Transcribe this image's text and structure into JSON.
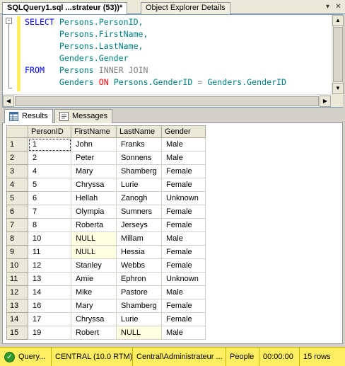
{
  "doc_tabs": [
    {
      "label": "SQLQuery1.sql ...strateur (53))*",
      "active": true
    },
    {
      "label": "Object Explorer Details",
      "active": false
    }
  ],
  "window_buttons": {
    "dropdown_icon": "dropdown-arrow-icon",
    "close_icon": "close-icon"
  },
  "editor": {
    "lines": [
      {
        "t1": "SELECT",
        "t2": "Persons.PersonID,"
      },
      {
        "t1": "",
        "t2": "Persons.FirstName,"
      },
      {
        "t1": "",
        "t2": "Persons.LastName,"
      },
      {
        "t1": "",
        "t2": "Genders.Gender"
      },
      {
        "t1": "FROM",
        "t2": "Persons",
        "t3": "INNER JOIN"
      },
      {
        "t1": "",
        "t2": "Genders",
        "t3": "ON",
        "t4": "Persons.GenderID",
        "t5": "=",
        "t6": "Genders.GenderID"
      }
    ],
    "collapse_symbol": "-"
  },
  "result_tabs": [
    {
      "label": "Results",
      "icon": "grid-icon",
      "active": true
    },
    {
      "label": "Messages",
      "icon": "messages-icon",
      "active": false
    }
  ],
  "grid": {
    "columns": [
      "PersonID",
      "FirstName",
      "LastName",
      "Gender"
    ],
    "rows": [
      {
        "n": "1",
        "cells": [
          "1",
          "John",
          "Franks",
          "Male"
        ]
      },
      {
        "n": "2",
        "cells": [
          "2",
          "Peter",
          "Sonnens",
          "Male"
        ]
      },
      {
        "n": "3",
        "cells": [
          "4",
          "Mary",
          "Shamberg",
          "Female"
        ]
      },
      {
        "n": "4",
        "cells": [
          "5",
          "Chryssa",
          "Lurie",
          "Female"
        ]
      },
      {
        "n": "5",
        "cells": [
          "6",
          "Hellah",
          "Zanogh",
          "Unknown"
        ]
      },
      {
        "n": "6",
        "cells": [
          "7",
          "Olympia",
          "Sumners",
          "Female"
        ]
      },
      {
        "n": "7",
        "cells": [
          "8",
          "Roberta",
          "Jerseys",
          "Female"
        ]
      },
      {
        "n": "8",
        "cells": [
          "10",
          "NULL",
          "Millam",
          "Male"
        ]
      },
      {
        "n": "9",
        "cells": [
          "11",
          "NULL",
          "Hessia",
          "Female"
        ]
      },
      {
        "n": "10",
        "cells": [
          "12",
          "Stanley",
          "Webbs",
          "Female"
        ]
      },
      {
        "n": "11",
        "cells": [
          "13",
          "Amie",
          "Ephron",
          "Unknown"
        ]
      },
      {
        "n": "12",
        "cells": [
          "14",
          "Mike",
          "Pastore",
          "Male"
        ]
      },
      {
        "n": "13",
        "cells": [
          "16",
          "Mary",
          "Shamberg",
          "Female"
        ]
      },
      {
        "n": "14",
        "cells": [
          "17",
          "Chryssa",
          "Lurie",
          "Female"
        ]
      },
      {
        "n": "15",
        "cells": [
          "19",
          "Robert",
          "NULL",
          "Male"
        ]
      }
    ]
  },
  "status_bar": {
    "state_icon": "success-check-icon",
    "state": "Query...",
    "server": "CENTRAL (10.0 RTM)",
    "user": "Central\\Administrateur ...",
    "database": "People",
    "elapsed": "00:00:00",
    "rows": "15 rows"
  },
  "colors": {
    "keyword": "#0000ff",
    "identifier": "#008080",
    "operator_gray": "#808080",
    "on_keyword": "#ff0000",
    "status_bar": "#ffee62",
    "null_cell": "#ffffe1"
  }
}
